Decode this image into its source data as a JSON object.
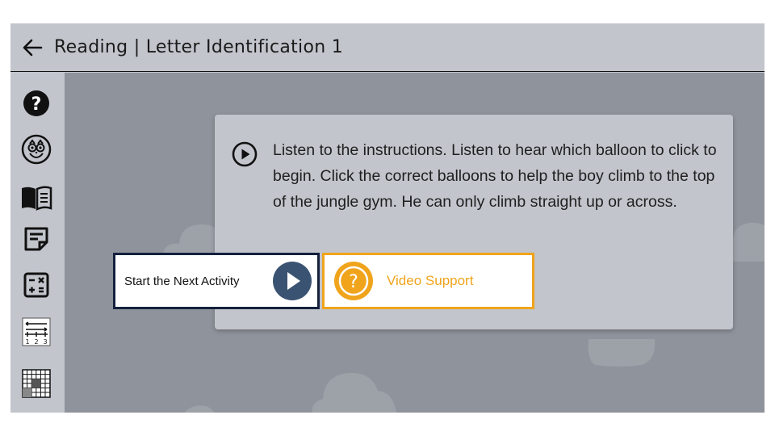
{
  "header": {
    "back_icon": "arrow-left-icon",
    "title": "Reading | Letter Identification 1"
  },
  "sidebar": {
    "items": [
      {
        "name": "help",
        "icon": "question-circle-icon"
      },
      {
        "name": "owl",
        "icon": "owl-icon"
      },
      {
        "name": "book",
        "icon": "open-book-icon"
      },
      {
        "name": "notes",
        "icon": "sticky-note-icon"
      },
      {
        "name": "calculator",
        "icon": "calculator-icon"
      },
      {
        "name": "number-line",
        "icon": "number-line-icon"
      },
      {
        "name": "hundred-chart",
        "icon": "grid-chart-icon"
      }
    ],
    "number_line_labels": [
      "1",
      "2",
      "3"
    ]
  },
  "dialog": {
    "instructions": "Listen to the instructions. Listen to hear which balloon to click to begin. Click the correct balloons to help the boy climb to the top of the jungle gym. He can only climb straight up or across.",
    "next_button_label": "Start the Next Activity",
    "video_button_label": "Video Support",
    "video_icon_glyph": "?"
  },
  "colors": {
    "header_bg": "#c2c5cc",
    "stage_bg": "#8f939b",
    "next_border": "#14213d",
    "next_icon": "#3b5372",
    "video_accent": "#f0a41c"
  }
}
